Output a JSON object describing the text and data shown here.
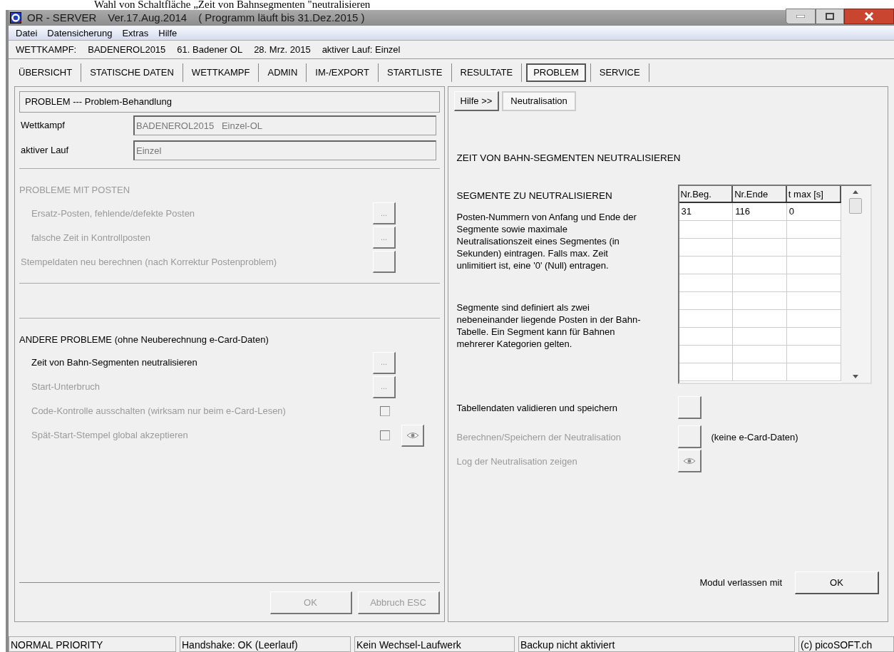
{
  "document_caption": "Wahl von Schaltfläche „Zeit von Bahnsegmenten \"neutralisieren",
  "window": {
    "title": "OR - SERVER",
    "version": "Ver.17.Aug.2014",
    "license": "( Programm läuft bis 31.Dez.2015 )"
  },
  "menu": [
    "Datei",
    "Datensicherung",
    "Extras",
    "Hilfe"
  ],
  "info_bar": [
    "WETTKAMPF:",
    "BADENEROL2015",
    "61. Badener OL",
    "28. Mrz. 2015",
    "aktiver Lauf: Einzel"
  ],
  "tabs": [
    {
      "label": "ÜBERSICHT",
      "selected": false
    },
    {
      "label": "STATISCHE DATEN",
      "selected": false
    },
    {
      "label": "WETTKAMPF",
      "selected": false
    },
    {
      "label": "ADMIN",
      "selected": false
    },
    {
      "label": "IM-/EXPORT",
      "selected": false
    },
    {
      "label": "STARTLISTE",
      "selected": false
    },
    {
      "label": "RESULTATE",
      "selected": false
    },
    {
      "label": "PROBLEM",
      "selected": true
    },
    {
      "label": "SERVICE",
      "selected": false
    }
  ],
  "left_panel": {
    "header": "PROBLEM --- Problem-Behandlung",
    "fields": [
      {
        "label": "Wettkampf",
        "value": "BADENEROL2015   Einzel-OL"
      },
      {
        "label": "aktiver Lauf",
        "value": "Einzel"
      }
    ],
    "sections": [
      {
        "title": "PROBLEME MIT POSTEN",
        "disabled": true,
        "items": [
          {
            "kind": "dots",
            "label": "Ersatz-Posten, fehlende/defekte Posten",
            "button_label": "...",
            "disabled": true
          },
          {
            "kind": "dots",
            "label": "falsche Zeit in Kontrollposten",
            "button_label": "...",
            "disabled": true
          },
          {
            "kind": "blank",
            "label": "Stempeldaten neu berechnen (nach Korrektur Postenproblem)",
            "disabled": true
          }
        ]
      },
      {
        "title": "ANDERE PROBLEME (ohne Neuberechnung e-Card-Daten)",
        "disabled": false,
        "items": [
          {
            "kind": "dots",
            "label": "Zeit von Bahn-Segmenten neutralisieren",
            "button_label": "...",
            "disabled": false
          },
          {
            "kind": "dots",
            "label": "Start-Unterbruch",
            "button_label": "...",
            "disabled": true
          },
          {
            "kind": "checkbox",
            "label": "Code-Kontrolle ausschalten (wirksam nur beim e-Card-Lesen)",
            "checked": false,
            "disabled": true
          },
          {
            "kind": "checkbox_eye",
            "label": "Spät-Start-Stempel global akzeptieren",
            "checked": false,
            "disabled": true
          }
        ]
      }
    ],
    "buttons": [
      {
        "label": "OK",
        "disabled": true
      },
      {
        "label": "Abbruch ESC",
        "disabled": true
      }
    ]
  },
  "right_panel": {
    "tabs": [
      {
        "label": "Hilfe >>",
        "selected": false
      },
      {
        "label": "Neutralisation",
        "selected": true
      }
    ],
    "title": "ZEIT VON BAHN-SEGMENTEN NEUTRALISIEREN",
    "subtitle": "SEGMENTE ZU NEUTRALISIEREN",
    "paragraphs": [
      "Posten-Nummern von Anfang und Ende der Segmente sowie maximale Neutralisationszeit eines Segmentes (in Sekunden) eintragen. Falls max. Zeit unlimitiert ist, eine '0' (Null) entragen.",
      "Segmente sind definiert als zwei nebeneinander liegende Posten in der Bahn-Tabelle. Ein Segment kann für Bahnen mehrerer Kategorien gelten."
    ],
    "table": {
      "columns": [
        "Nr.Beg.",
        "Nr.Ende",
        "t max [s]"
      ],
      "rows": [
        [
          "31",
          "116",
          "0"
        ]
      ]
    },
    "actions": [
      {
        "kind": "blank",
        "label": "Tabellendaten validieren und speichern",
        "disabled": false
      },
      {
        "kind": "blank",
        "label": "Berechnen/Speichern der Neutralisation",
        "disabled": true,
        "note": "(keine e-Card-Daten)"
      },
      {
        "kind": "eye",
        "label": "Log der Neutralisation zeigen",
        "disabled": true
      }
    ],
    "exit": {
      "label": "Modul verlassen mit",
      "button": "OK"
    }
  },
  "status_bar": [
    "NORMAL PRIORITY",
    "Handshake: OK (Leerlauf)",
    "Kein Wechsel-Laufwerk",
    "Backup nicht aktiviert",
    "(c) picoSOFT.ch"
  ]
}
